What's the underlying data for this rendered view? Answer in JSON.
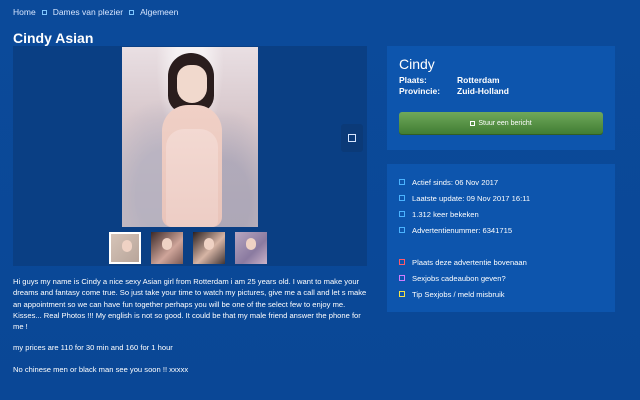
{
  "breadcrumb": {
    "items": [
      "Home",
      "Dames van plezier",
      "Algemeen"
    ]
  },
  "page": {
    "title": "Cindy Asian"
  },
  "gallery": {
    "main_photo": "profile-photo",
    "thumbnails": [
      "thumbnail-1",
      "thumbnail-2",
      "thumbnail-3",
      "thumbnail-4"
    ],
    "next_icon": "square-icon"
  },
  "description": {
    "paragraphs": [
      "Hi guys my name is Cindy a nice sexy Asian girl from Rotterdam i am 25 years old. I want to make your dreams and fantasy come true. So just take your time to watch my pictures, give me a call and let s make an appointment so we can have fun together perhaps you will be one of the select few to enjoy me. Kisses... Real Photos !!! My english is not so good. It could be that my male friend answer the phone for me !",
      "my prices are 110 for 30 min and 160 for 1 hour",
      "No chinese men or black man see you soon !! xxxxx"
    ]
  },
  "contact": {
    "name": "Cindy",
    "fields": [
      {
        "label": "Plaats:",
        "value": "Rotterdam"
      },
      {
        "label": "Provincie:",
        "value": "Zuid-Holland"
      }
    ],
    "button_label": "Stuur een bericht",
    "button_icon": "message-icon"
  },
  "info": {
    "items": [
      "Actief sinds: 06 Nov 2017",
      "Laatste update: 09 Nov 2017 16:11",
      "1.312 keer bekeken",
      "Advertentienummer: 6341715"
    ],
    "actions": [
      {
        "label": "Plaats deze advertentie bovenaan",
        "color": "#ff5a6a"
      },
      {
        "label": "Sexjobs cadeaubon geven?",
        "color": "#d07cff"
      },
      {
        "label": "Tip Sexjobs / meld misbruik",
        "color": "#f2e24a"
      }
    ]
  },
  "colors": {
    "background": "#0b4a9a",
    "panel": "#0d55ad",
    "accent": "#4ab3ff",
    "button_green": "#4f8e40"
  }
}
